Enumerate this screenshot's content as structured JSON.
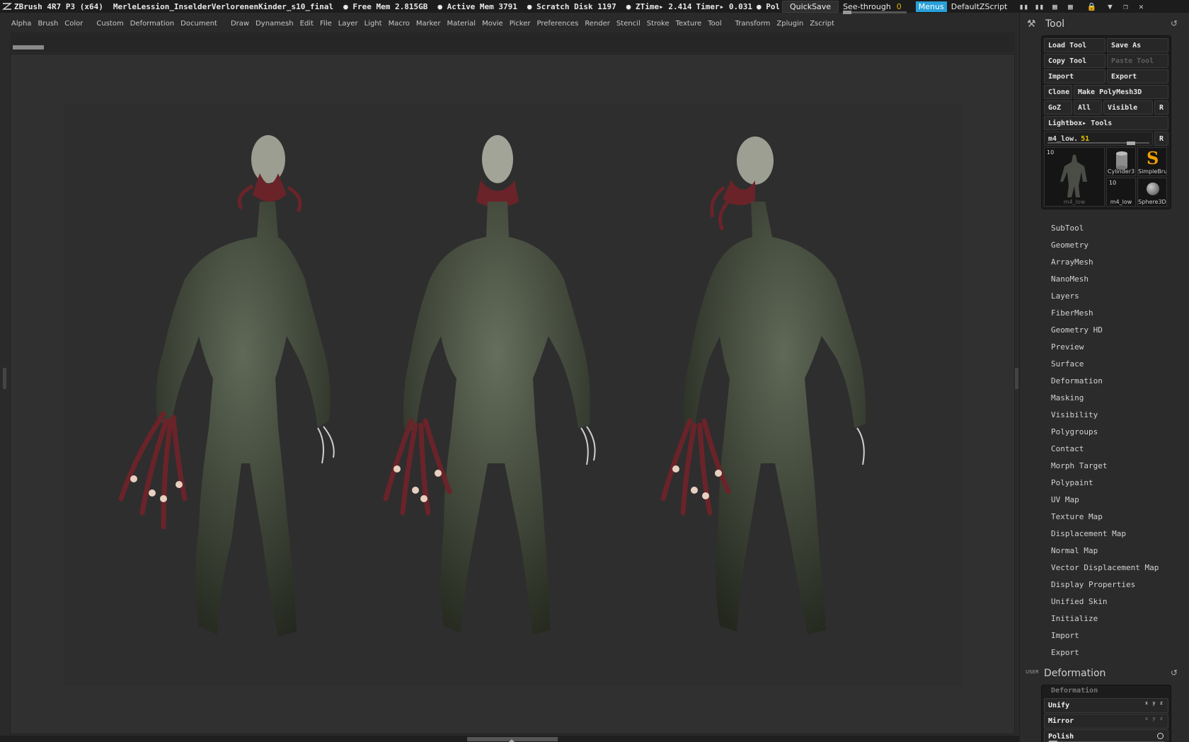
{
  "titlebar": {
    "app": "ZBrush 4R7 P3 (x64)",
    "document": "MerleLession_InselderVerlorenenKinder_s10_final",
    "free_mem": "● Free Mem 2.815GB",
    "active_mem": "● Active Mem 3791",
    "scratch_disk": "● Scratch Disk 1197",
    "ztime": "● ZTime▸ 2.414",
    "timer": "Timer▸ 0.031",
    "poly": "● Poly(",
    "quicksave": "QuickSave",
    "see_through_label": "See-through",
    "see_through_value": "0",
    "menus": "Menus",
    "script": "DefaultZScript"
  },
  "menus": [
    "Alpha",
    "Brush",
    "Color",
    "Custom",
    "Deformation",
    "Document",
    "Draw",
    "Dynamesh",
    "Edit",
    "File",
    "Layer",
    "Light",
    "Macro",
    "Marker",
    "Material",
    "Movie",
    "Picker",
    "Preferences",
    "Render",
    "Stencil",
    "Stroke",
    "Texture",
    "Tool",
    "Transform",
    "Zplugin",
    "Zscript"
  ],
  "tool_panel": {
    "title": "Tool",
    "load_tool": "Load Tool",
    "save_as": "Save As",
    "copy_tool": "Copy Tool",
    "paste_tool": "Paste Tool",
    "import": "Import",
    "export": "Export",
    "clone": "Clone",
    "make_polymesh": "Make PolyMesh3D",
    "goz": "GoZ",
    "all": "All",
    "visible": "Visible",
    "r": "R",
    "lightbox": "Lightbox▸ Tools",
    "current_tool": "m4_low.",
    "current_tool_num": "51",
    "thumbs": {
      "big_num": "10",
      "big_label": "m4_low",
      "cyl": "Cylinder3",
      "simple": "SimpleBru",
      "small_num": "10",
      "small_label": "m4_low",
      "sphere": "Sphere3D"
    }
  },
  "subpalettes": [
    "SubTool",
    "Geometry",
    "ArrayMesh",
    "NanoMesh",
    "Layers",
    "FiberMesh",
    "Geometry HD",
    "Preview",
    "Surface",
    "Deformation",
    "Masking",
    "Visibility",
    "Polygroups",
    "Contact",
    "Morph Target",
    "Polypaint",
    "UV Map",
    "Texture Map",
    "Displacement Map",
    "Normal Map",
    "Vector Displacement Map",
    "Display Properties",
    "Unified Skin",
    "Initialize",
    "Import",
    "Export"
  ],
  "deformation_panel": {
    "user_tag": "USER",
    "title": "Deformation",
    "box_title": "Deformation",
    "unify": "Unify",
    "mirror": "Mirror",
    "polish": "Polish",
    "xyz": "x y z"
  },
  "colors": {
    "accent": "#28a0d8",
    "value_yellow": "#e8c000",
    "skin": "#3d4438",
    "tentacle": "#6a2329"
  }
}
